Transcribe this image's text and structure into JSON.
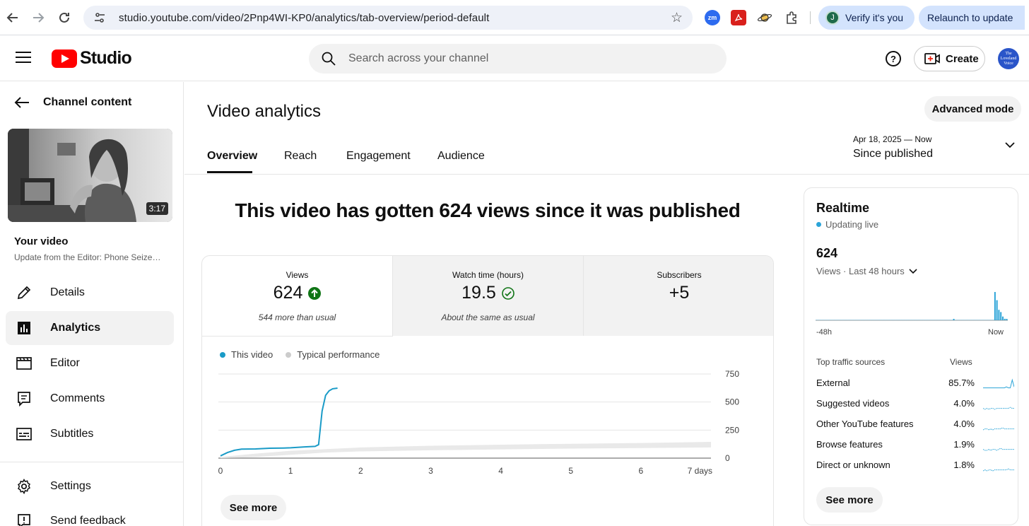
{
  "browser": {
    "url": "studio.youtube.com/video/2Pnp4WI-KP0/analytics/tab-overview/period-default",
    "verify_label": "Verify it's you",
    "verify_initial": "J",
    "relaunch_label": "Relaunch to update",
    "ext_zm": "zm"
  },
  "header": {
    "brand": "Studio",
    "search_placeholder": "Search across your channel",
    "create_label": "Create",
    "help_glyph": "?",
    "avatar_lines": [
      "The",
      "Loveland",
      "Voice"
    ]
  },
  "sidebar": {
    "back_label": "Channel content",
    "thumbnail_duration": "3:17",
    "your_video_label": "Your video",
    "video_title": "Update from the Editor: Phone Seize…",
    "items": [
      {
        "label": "Details",
        "icon": "pencil-icon"
      },
      {
        "label": "Analytics",
        "icon": "analytics-icon",
        "active": true
      },
      {
        "label": "Editor",
        "icon": "film-icon"
      },
      {
        "label": "Comments",
        "icon": "comment-icon"
      },
      {
        "label": "Subtitles",
        "icon": "subtitles-icon"
      },
      {
        "label": "Settings",
        "icon": "gear-icon"
      },
      {
        "label": "Send feedback",
        "icon": "feedback-icon"
      }
    ]
  },
  "main": {
    "title": "Video analytics",
    "advanced_mode_label": "Advanced mode",
    "tabs": [
      {
        "label": "Overview",
        "active": true
      },
      {
        "label": "Reach"
      },
      {
        "label": "Engagement"
      },
      {
        "label": "Audience"
      }
    ],
    "date_range": "Apr 18, 2025 — Now",
    "date_label": "Since published",
    "headline": "This video has gotten 624 views since it was published",
    "metrics": [
      {
        "label": "Views",
        "value": "624",
        "sub": "544 more than usual",
        "status": "up"
      },
      {
        "label": "Watch time (hours)",
        "value": "19.5",
        "sub": "About the same as usual",
        "status": "same"
      },
      {
        "label": "Subscribers",
        "value": "+5",
        "sub": ""
      }
    ],
    "legend": {
      "this_video": "This video",
      "typical": "Typical performance"
    },
    "see_more_label": "See more",
    "colors": {
      "accent": "#1a9bc7",
      "typical": "#e9e9e9",
      "up_green": "#107516"
    }
  },
  "chart_data": {
    "type": "line",
    "xlabel": "",
    "ylabel": "",
    "x_tick_labels": [
      "0",
      "1",
      "2",
      "3",
      "4",
      "5",
      "6",
      "7 days"
    ],
    "x_ticks": [
      0,
      1,
      2,
      3,
      4,
      5,
      6,
      7
    ],
    "y_ticks": [
      0,
      250,
      500,
      750
    ],
    "xlim": [
      0,
      7
    ],
    "ylim": [
      0,
      750
    ],
    "grid": true,
    "legend_position": "top-left",
    "series": [
      {
        "name": "This video",
        "x": [
          0,
          0.1,
          0.2,
          0.3,
          0.5,
          0.7,
          0.9,
          1.0,
          1.2,
          1.35,
          1.4,
          1.45,
          1.5,
          1.55,
          1.6,
          1.67
        ],
        "y": [
          20,
          50,
          70,
          80,
          82,
          88,
          90,
          92,
          100,
          105,
          120,
          420,
          560,
          600,
          618,
          624
        ]
      },
      {
        "name": "Typical performance",
        "x": [
          0,
          0.5,
          1,
          1.5,
          2,
          3,
          4,
          5,
          6,
          7
        ],
        "y_low": [
          0,
          10,
          30,
          50,
          60,
          70,
          78,
          85,
          90,
          95
        ],
        "y_high": [
          10,
          40,
          65,
          80,
          95,
          110,
          120,
          128,
          135,
          145
        ]
      }
    ]
  },
  "realtime": {
    "title": "Realtime",
    "live_label": "Updating live",
    "count": "624",
    "scope_label": "Views · Last 48 hours",
    "axis_left": "-48h",
    "axis_right": "Now",
    "bars": [
      0,
      0,
      0,
      0,
      0,
      0,
      0,
      0,
      0,
      0,
      0,
      0,
      0,
      0,
      0,
      0,
      0,
      0,
      0,
      0,
      0,
      0,
      0,
      0,
      0,
      0,
      0,
      0,
      0,
      0,
      0,
      0,
      0,
      0,
      0,
      0,
      0,
      0,
      0,
      0,
      0,
      0,
      0,
      0,
      0,
      0,
      0,
      0,
      0,
      0,
      0,
      0,
      0,
      0,
      0,
      0,
      0,
      0,
      0,
      0,
      0,
      0,
      0,
      0,
      0,
      0,
      0,
      0,
      0,
      0,
      1,
      0,
      0,
      0,
      0,
      0,
      0,
      0,
      0,
      0,
      0,
      0,
      0,
      0,
      0,
      0,
      0,
      0,
      0,
      0,
      0,
      38,
      27,
      14,
      11,
      5,
      2,
      1
    ],
    "traffic_header": "Top traffic sources",
    "views_header": "Views",
    "traffic_sources": [
      {
        "name": "External",
        "pct": "85.7%"
      },
      {
        "name": "Suggested videos",
        "pct": "4.0%"
      },
      {
        "name": "Other YouTube features",
        "pct": "4.0%"
      },
      {
        "name": "Browse features",
        "pct": "1.9%"
      },
      {
        "name": "Direct or unknown",
        "pct": "1.8%"
      }
    ],
    "see_more_label": "See more"
  }
}
